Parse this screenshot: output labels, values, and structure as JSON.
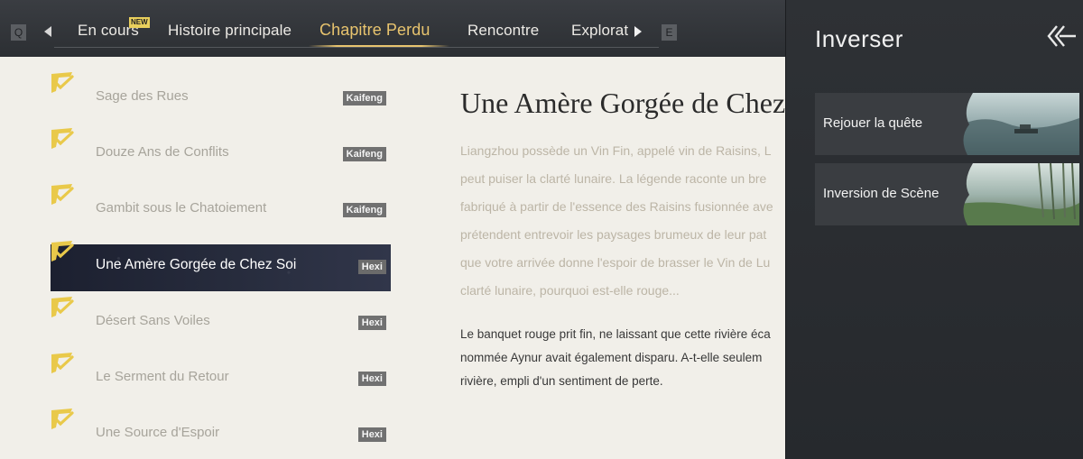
{
  "nav": {
    "key_left": "Q",
    "key_right": "E",
    "new_badge": "NEW",
    "tabs": [
      {
        "label": "En cours",
        "active": false
      },
      {
        "label": "Histoire principale",
        "active": false
      },
      {
        "label": "Chapitre Perdu",
        "active": true
      },
      {
        "label": "Rencontre",
        "active": false
      },
      {
        "label": "Explorat",
        "active": false
      }
    ]
  },
  "quests": [
    {
      "title": "Sage des Rues",
      "region": "Kaifeng",
      "completed": true,
      "selected": false
    },
    {
      "title": "Douze Ans de Conflits",
      "region": "Kaifeng",
      "completed": true,
      "selected": false
    },
    {
      "title": "Gambit sous le Chatoiement",
      "region": "Kaifeng",
      "completed": true,
      "selected": false
    },
    {
      "title": "Une Amère Gorgée de Chez Soi",
      "region": "Hexi",
      "completed": true,
      "selected": true
    },
    {
      "title": "Désert Sans Voiles",
      "region": "Hexi",
      "completed": true,
      "selected": false
    },
    {
      "title": "Le Serment du Retour",
      "region": "Hexi",
      "completed": true,
      "selected": false
    },
    {
      "title": "Une Source d'Espoir",
      "region": "Hexi",
      "completed": true,
      "selected": false
    }
  ],
  "detail": {
    "title": "Une Amère Gorgée de Chez",
    "description_lines": [
      "Liangzhou possède un Vin Fin, appelé vin de Raisins, L",
      "peut puiser la clarté lunaire. La légende raconte un bre",
      "fabriqué à partir de l'essence des Raisins fusionnée ave",
      "prétendent entrevoir les paysages brumeux de leur pat",
      "que votre arrivée donne l'espoir de brasser le Vin de Lu",
      "clarté lunaire, pourquoi est-elle rouge..."
    ],
    "note_lines": [
      "Le banquet rouge prit fin, ne laissant que cette rivière éca",
      "nommée Aynur avait également disparu. A-t-elle seulem",
      "rivière, empli d'un sentiment de perte."
    ]
  },
  "panel": {
    "title": "Inverser",
    "options": [
      {
        "label": "Rejouer la quête",
        "thumbnail": "misty-lake-boat"
      },
      {
        "label": "Inversion de Scène",
        "thumbnail": "bamboo-riverbank"
      }
    ]
  },
  "colors": {
    "accent": "#e8c46e",
    "topbar": "#2f3236",
    "panel": "#2b2e32",
    "page": "#f1efe9",
    "selected_row": "#262b3b",
    "region_badge": "#717171"
  }
}
